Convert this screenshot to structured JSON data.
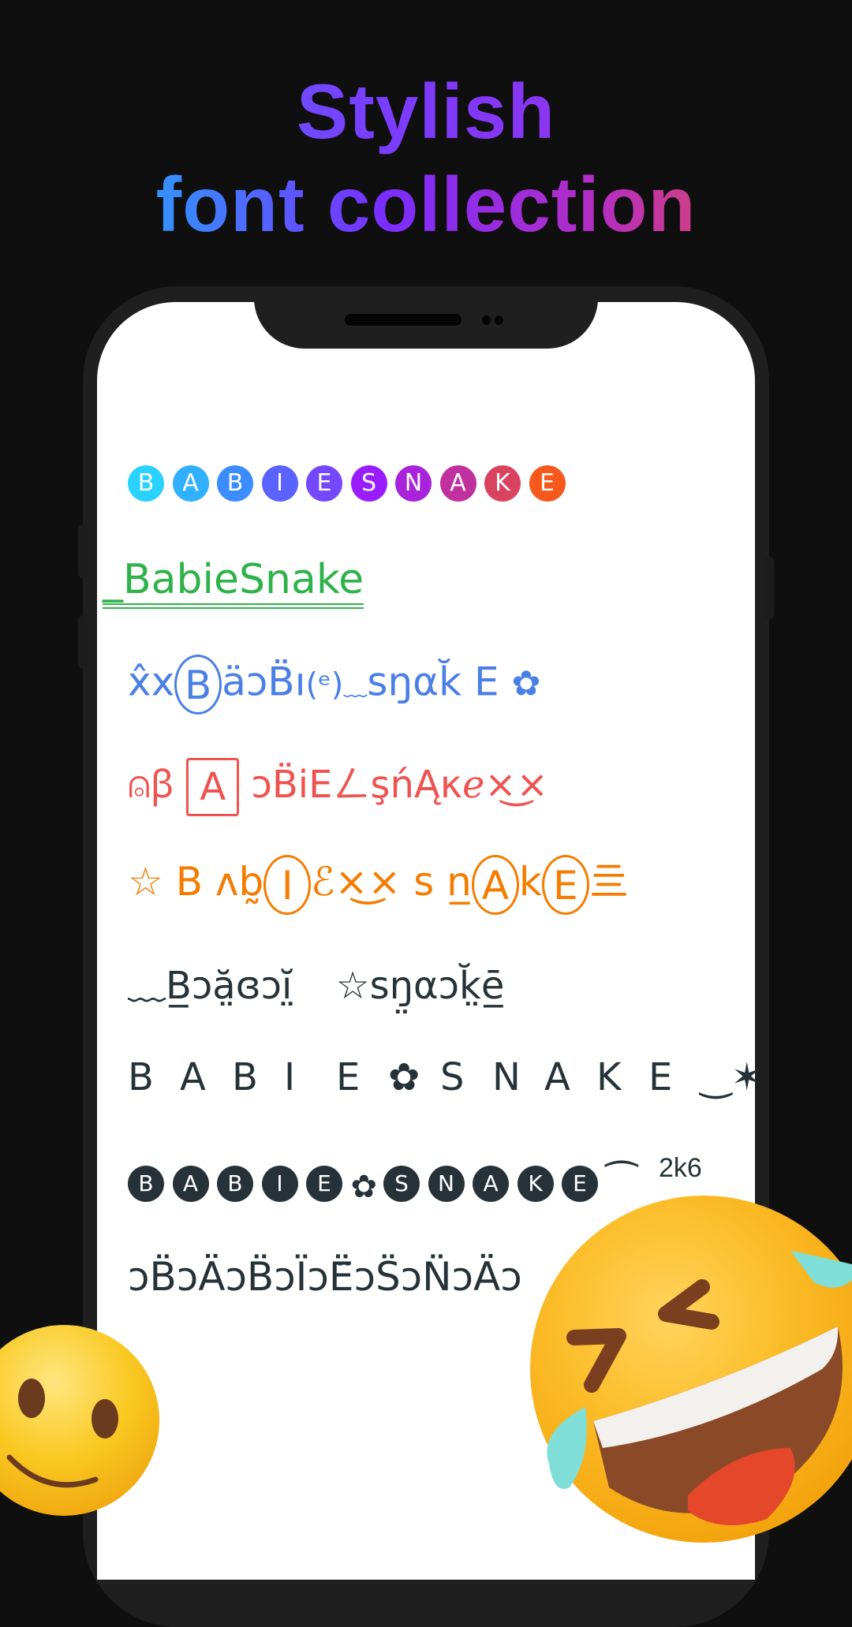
{
  "headline": {
    "line1": "Stylish",
    "line2": "font collection",
    "gradient_colors": [
      "#27c9ff",
      "#3b86ff",
      "#7a2dff",
      "#b42dc4",
      "#f45a2a"
    ]
  },
  "font_samples": [
    {
      "style": "gradient-circled",
      "letters": [
        "B",
        "A",
        "B",
        "I",
        "E",
        "S",
        "N",
        "A",
        "K",
        "E"
      ],
      "colors": [
        "#2ad3ff",
        "#30b0ff",
        "#3a8cff",
        "#5a62ff",
        "#7448ff",
        "#9a1dff",
        "#a823d9",
        "#c0309f",
        "#d9435f",
        "#f7581b"
      ]
    },
    {
      "style": "green-double-underline",
      "prefix": "_",
      "text": "BabieSnake",
      "color": "#2fb24a"
    },
    {
      "style": "blue-decorated",
      "prefix": "x̂x",
      "ring_letter": "B",
      "mid": "äɔB̈ı",
      "paren": "(ᵉ)",
      "wave": "﹏",
      "tail": "sŋαk̆ E",
      "flower": "✿",
      "color": "#4a7fe6"
    },
    {
      "style": "red-decorated",
      "head": "⍝ꞵ",
      "box_letter": "A",
      "tail": "ɔB̈iEㄥşńĄκℯ×͜×",
      "color": "#ef5350"
    },
    {
      "style": "orange-decorated",
      "star": "☆",
      "part1": "B ᴧb̰",
      "ring1": "I",
      "part2": "ℰ×͜× s n̲",
      "ring2": "A",
      "part3": "k",
      "ring3": "E",
      "end": "亖",
      "color": "#f57c00"
    },
    {
      "style": "dark-wavy",
      "part1": "﹏B̲ɔă̤ɞɔĭ̤",
      "star": "☆",
      "part2": "sŋ̤αɔk̤̆ē̲",
      "color": "#263238"
    },
    {
      "style": "dark-spaced",
      "letters1": [
        "B",
        "A",
        "B",
        "I",
        "E"
      ],
      "flower": "✿",
      "letters2": [
        "S",
        "N",
        "A",
        "K",
        "E"
      ],
      "end": "‿✶",
      "color": "#263238"
    },
    {
      "style": "dark-circled",
      "letters1": [
        "B",
        "A",
        "B",
        "I",
        "E"
      ],
      "flower": "✿",
      "letters2": [
        "S",
        "N",
        "A",
        "K",
        "E"
      ],
      "end": "⁀",
      "badge": "2k6",
      "color": "#263238"
    },
    {
      "style": "dark-arabic-marks",
      "text": "ɔB̈ɔÄɔB̈ɔÏɔË̈ɔS̈ɔN̈ɔÄɔ",
      "color": "#263238"
    }
  ],
  "decorations": {
    "emoji_left": "slightly-smiling-face",
    "emoji_right": "rolling-on-floor-laughing"
  }
}
